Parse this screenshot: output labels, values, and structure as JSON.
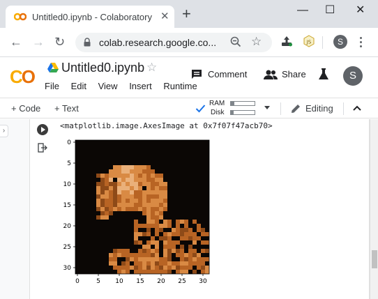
{
  "browser": {
    "tab_title": "Untitled0.ipynb - Colaboratory",
    "tab_close": "✕",
    "new_tab": "+",
    "window_controls": {
      "minimize": "—",
      "maximize": "☐",
      "close": "✕"
    },
    "back": "←",
    "forward": "→",
    "reload": "↻",
    "url": "colab.research.google.co...",
    "star": "☆",
    "profile_initial": "S"
  },
  "colab": {
    "notebook_title": "Untitled0.ipynb",
    "title_star": "☆",
    "menu": [
      "File",
      "Edit",
      "View",
      "Insert",
      "Runtime"
    ],
    "comment_label": "Comment",
    "share_label": "Share",
    "avatar_initial": "S"
  },
  "toolbar": {
    "add_code": "+ Code",
    "add_text": "+ Text",
    "ram_label": "RAM",
    "disk_label": "Disk",
    "ram_level": 0.15,
    "disk_level": 0.12,
    "editing_label": "Editing",
    "collapse": "^"
  },
  "cell": {
    "output_text": "<matplotlib.image.AxesImage at 0x7f07f47acb70>",
    "plot": {
      "x_ticks": [
        "0",
        "5",
        "10",
        "15",
        "20",
        "25",
        "30"
      ],
      "y_ticks": [
        "0",
        "5",
        "10",
        "15",
        "20",
        "25",
        "30"
      ]
    }
  },
  "colors": {
    "logo_yellow": "#f9ab00",
    "logo_orange": "#e8710a",
    "accent_blue": "#1a73e8"
  }
}
